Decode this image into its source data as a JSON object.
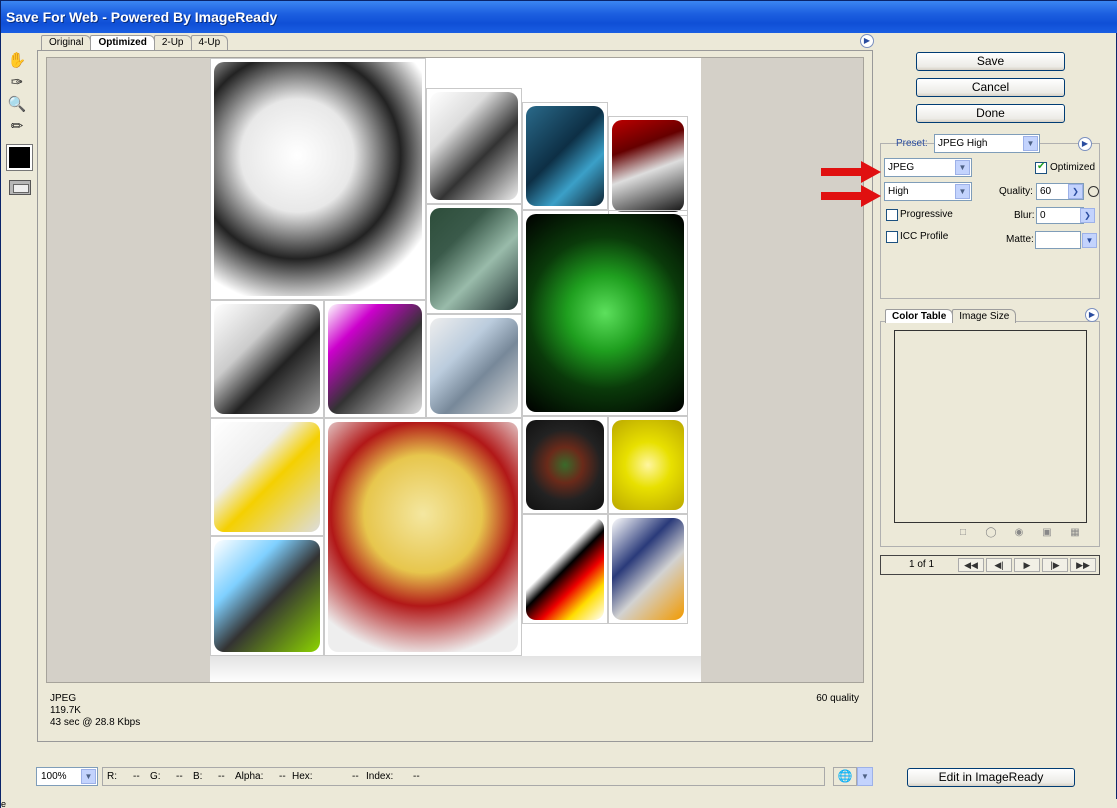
{
  "window": {
    "title": "Save For Web - Powered By ImageReady"
  },
  "tabs": [
    {
      "label": "Original"
    },
    {
      "label": "Optimized"
    },
    {
      "label": "2-Up"
    },
    {
      "label": "4-Up"
    }
  ],
  "active_tab": "Optimized",
  "tools": [
    "hand-tool",
    "slice-select-tool",
    "zoom-tool",
    "eyedropper-tool"
  ],
  "eyedropper_color": "#000000",
  "image_info": {
    "format": "JPEG",
    "size": "119.7K",
    "download_time": "43 sec @ 28.8 Kbps",
    "quality_note": "60 quality"
  },
  "buttons": {
    "save": "Save",
    "cancel": "Cancel",
    "done": "Done",
    "edit_in_imageready": "Edit in ImageReady"
  },
  "settings": {
    "preset_label": "Preset:",
    "preset_value": "JPEG High",
    "format_value": "JPEG",
    "quality_level": "High",
    "optimized_label": "Optimized",
    "optimized_checked": true,
    "quality_label": "Quality:",
    "quality_value": "60",
    "progressive_label": "Progressive",
    "progressive_checked": false,
    "blur_label": "Blur:",
    "blur_value": "0",
    "icc_label": "ICC Profile",
    "icc_checked": false,
    "matte_label": "Matte:",
    "matte_value": ""
  },
  "panel_tabs": [
    {
      "label": "Color Table"
    },
    {
      "label": "Image Size"
    }
  ],
  "animation": {
    "frame_counter": "1 of 1"
  },
  "status": {
    "zoom": "100%",
    "r_label": "R:",
    "r_value": "--",
    "g_label": "G:",
    "g_value": "--",
    "b_label": "B:",
    "b_value": "--",
    "alpha_label": "Alpha:",
    "alpha_value": "--",
    "hex_label": "Hex:",
    "hex_value": "--",
    "index_label": "Index:",
    "index_value": "--"
  },
  "bottom_text": "e",
  "colors": {
    "title_bar": "#1c5fe0",
    "window_bg": "#ece9d8",
    "accent_red": "#e01010"
  }
}
